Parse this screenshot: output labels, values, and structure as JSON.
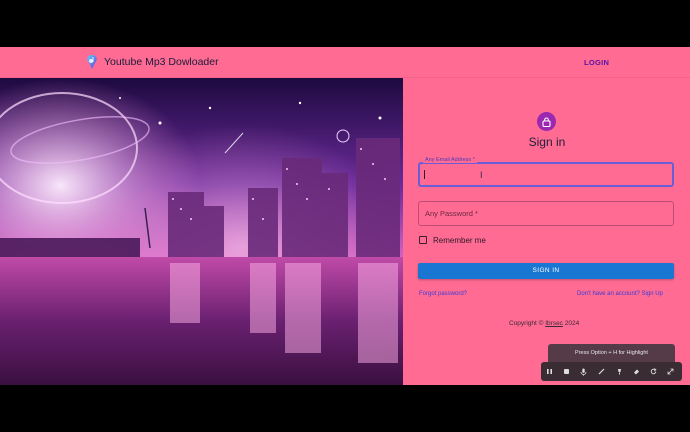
{
  "app": {
    "title": "Youtube Mp3 Dowloader",
    "login_label": "LOGIN",
    "brand_color": "#ff6b92"
  },
  "signin": {
    "title": "Sign in",
    "email_label": "Any Email Address",
    "email_value": "",
    "password_label": "Any Password",
    "remember_label": "Remember me",
    "remember_checked": false,
    "button_label": "SIGN IN",
    "button_color": "#1976d2",
    "forgot_label": "Forgot password?",
    "signup_label": "Don't have an account? Sign Up",
    "avatar_icon": "lock-icon",
    "avatar_color": "#9c27b0"
  },
  "footer": {
    "copyright_prefix": "Copyright © ",
    "copyright_owner": "Ibrsec",
    "copyright_year": " 2024"
  },
  "recorder": {
    "hint": "Press Option + H for Highlight",
    "tools": [
      "pause-icon",
      "stop-icon",
      "mic-icon",
      "pen-icon",
      "highlighter-icon",
      "eraser-icon",
      "undo-icon",
      "collapse-icon"
    ]
  },
  "hero": {
    "image": "neon-city-skyline-illustration"
  }
}
